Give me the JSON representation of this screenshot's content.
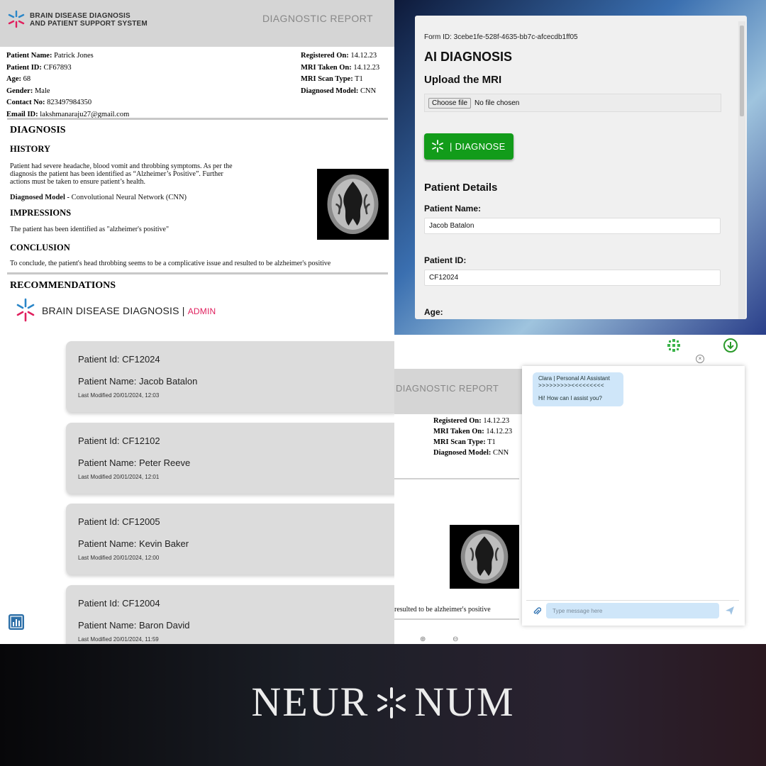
{
  "report": {
    "system_name_line1": "BRAIN DISEASE DIAGNOSIS",
    "system_name_line2": "AND PATIENT SUPPORT SYSTEM",
    "title": "DIAGNOSTIC REPORT",
    "patient_name_label": "Patient Name:",
    "patient_name": "Patrick Jones",
    "patient_id_label": "Patient ID:",
    "patient_id": "CF67893",
    "age_label": "Age:",
    "age": "68",
    "gender_label": "Gender:",
    "gender": "Male",
    "contact_label": "Contact No:",
    "contact": "823497984350",
    "email_label": "Email ID:",
    "email": "lakshmanaraju27@gmail.com",
    "registered_label": "Registered On:",
    "registered": "14.12.23",
    "mri_taken_label": "MRI Taken On:",
    "mri_taken": "14.12.23",
    "scan_type_label": "MRI Scan Type:",
    "scan_type": "T1",
    "model_label": "Diagnosed Model:",
    "model": "CNN",
    "diagnosis_heading": "DIAGNOSIS",
    "history_heading": "HISTORY",
    "history_line1": "Patient had severe headache, blood vomit and throbbing symptoms. As per the",
    "history_line2": "diagnosis the patient has been identified as “Alzheimer’s Positive”. Further",
    "history_line3": "actions must be taken to ensure patient’s health.",
    "diag_model_label": "Diagnosed Model -",
    "diag_model_value": "Convolutional Neural Network (CNN)",
    "impressions_heading": "IMPRESSIONS",
    "impressions_text": "The patient has been identified as \"alzheimer's positive\"",
    "conclusion_heading": "CONCLUSION",
    "conclusion_text": "To conclude, the patient's head throbbing seems to be a complicative issue and resulted to be alzheimer's positive",
    "recommendations_heading": "RECOMMENDATIONS"
  },
  "ai_form": {
    "form_id": "Form ID: 3cebe1fe-528f-4635-bb7c-afcecdb1ff05",
    "title": "AI DIAGNOSIS",
    "upload_heading": "Upload the MRI",
    "file_button": "Choose file",
    "file_status": "No file chosen",
    "diagnose_button": "| DIAGNOSE",
    "patient_details_heading": "Patient Details",
    "name_label": "Patient Name:",
    "name_value": "Jacob Batalon",
    "id_label": "Patient ID:",
    "id_value": "CF12024",
    "age_label": "Age:"
  },
  "admin": {
    "title": "BRAIN DISEASE DIAGNOSIS",
    "separator": "|",
    "role": "ADMIN",
    "patients": [
      {
        "id": "Patient Id: CF12024",
        "name": "Patient Name: Jacob Batalon",
        "modified": "Last Modified 20/01/2024, 12:03"
      },
      {
        "id": "Patient Id: CF12102",
        "name": "Patient Name: Peter Reeve",
        "modified": "Last Modified 20/01/2024, 12:01"
      },
      {
        "id": "Patient Id: CF12005",
        "name": "Patient Name: Kevin Baker",
        "modified": "Last Modified 20/01/2024, 12:00"
      },
      {
        "id": "Patient Id: CF12004",
        "name": "Patient Name: Baron David",
        "modified": "Last Modified 20/01/2024, 11:59"
      }
    ]
  },
  "chat_view": {
    "report_title": "DIAGNOSTIC REPORT",
    "registered_label": "Registered On:",
    "registered": "14.12.23",
    "mri_taken_label": "MRI Taken On:",
    "mri_taken": "14.12.23",
    "scan_type_label": "MRI Scan Type:",
    "scan_type": "T1",
    "model_label": "Diagnosed Model:",
    "model": "CNN",
    "conclusion_tail": "resulted to be alzheimer's positive",
    "assistant_name": "Clara | Personal AI Assistant",
    "assistant_arrows": ">>>>>>>>><<<<<<<<<",
    "assistant_greeting": "Hi! How can I assist you?",
    "message_placeholder": "Type message here",
    "icons": [
      "grid-icon",
      "download-icon",
      "close-icon",
      "attach-icon",
      "send-icon",
      "zoom-in-icon",
      "zoom-out-icon"
    ]
  },
  "banner": {
    "brand_left": "NEUR",
    "brand_right": "NUM"
  },
  "colors": {
    "diagnose_green": "#129c1a",
    "admin_pink": "#e0205e",
    "chat_bubble": "#cfe6f9"
  }
}
